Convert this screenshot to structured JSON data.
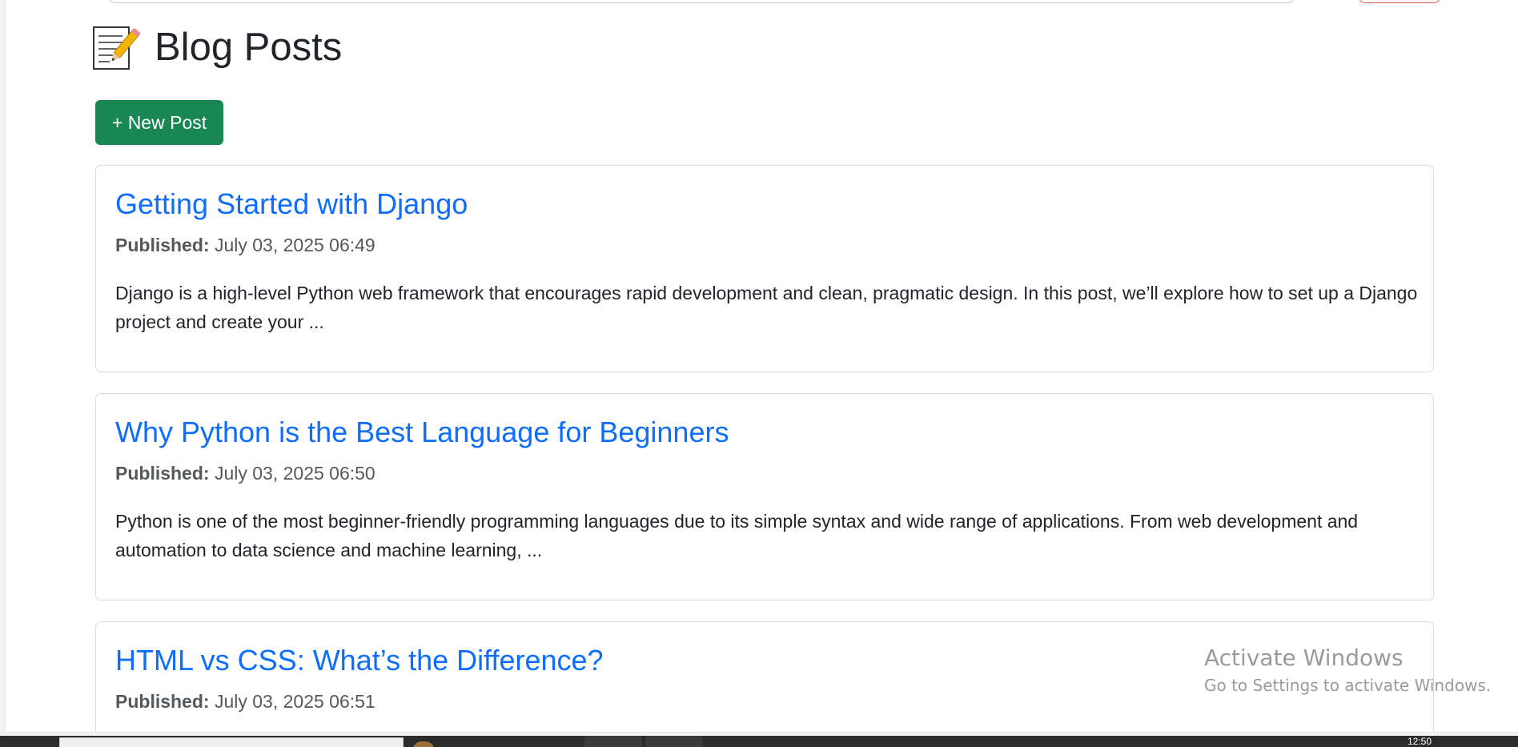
{
  "page": {
    "title": "Blog Posts",
    "title_icon": "memo-icon",
    "new_post_label": "+ New Post"
  },
  "posts": [
    {
      "title": "Getting Started with Django",
      "published_label": "Published:",
      "published_date": "July 03, 2025 06:49",
      "excerpt": "Django is a high-level Python web framework that encourages rapid development and clean, pragmatic design. In this post, we’ll explore how to set up a Django project and create your ..."
    },
    {
      "title": "Why Python is the Best Language for Beginners",
      "published_label": "Published:",
      "published_date": "July 03, 2025 06:50",
      "excerpt": "Python is one of the most beginner-friendly programming languages due to its simple syntax and wide range of applications. From web development and automation to data science and machine learning, ..."
    },
    {
      "title": "HTML vs CSS: What’s the Difference?",
      "published_label": "Published:",
      "published_date": "July 03, 2025 06:51",
      "excerpt": ""
    }
  ],
  "watermark": {
    "title": "Activate Windows",
    "subtitle": "Go to Settings to activate Windows."
  },
  "taskbar": {
    "clock": "12:50"
  },
  "colors": {
    "link": "#0d6efd",
    "button_success": "#198754",
    "text": "#212529",
    "muted": "#55595c"
  }
}
